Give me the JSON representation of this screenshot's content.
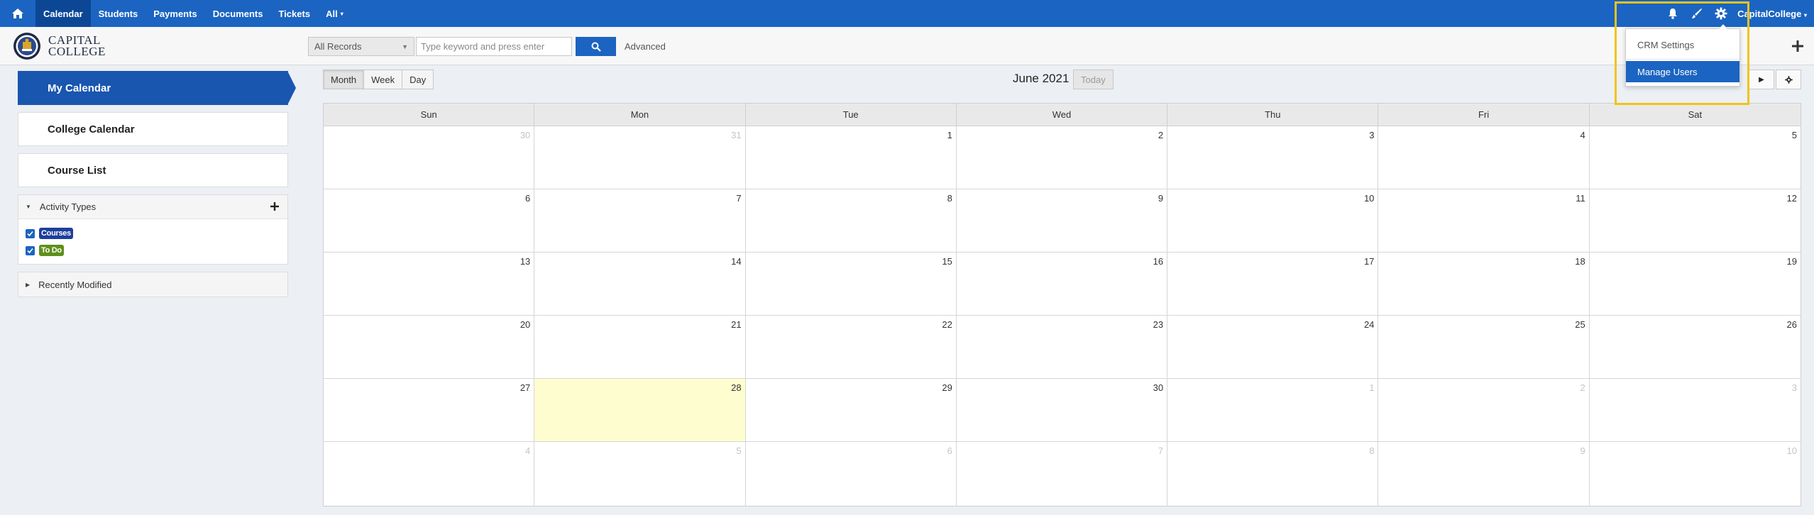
{
  "nav": {
    "items": [
      {
        "label": "Calendar",
        "active": true
      },
      {
        "label": "Students"
      },
      {
        "label": "Payments"
      },
      {
        "label": "Documents"
      },
      {
        "label": "Tickets"
      },
      {
        "label": "All",
        "caret": "▾"
      }
    ],
    "user": "CapitalCollege",
    "user_caret": "▾",
    "icons": [
      "home-icon",
      "bell-icon",
      "brush-icon",
      "gear-icon"
    ],
    "accent_color": "#1b64c1"
  },
  "logo": {
    "line1": "CAPITAL",
    "line2": "COLLEGE"
  },
  "search": {
    "records_select": "All Records",
    "placeholder": "Type keyword and press enter",
    "advanced": "Advanced"
  },
  "sidebar": {
    "buttons": [
      {
        "label": "My Calendar",
        "active": true
      },
      {
        "label": "College Calendar"
      },
      {
        "label": "Course List"
      }
    ],
    "activity_types": {
      "title": "Activity Types",
      "items": [
        {
          "label": "Courses",
          "checked": true,
          "color": "#1d3f9c"
        },
        {
          "label": "To Do",
          "checked": true,
          "color": "#5f8f1c"
        }
      ]
    },
    "recently_modified": {
      "title": "Recently Modified"
    }
  },
  "calendar": {
    "views": [
      "Month",
      "Week",
      "Day"
    ],
    "active_view": "Month",
    "title": "June 2021",
    "today_label": "Today",
    "weekdays": [
      "Sun",
      "Mon",
      "Tue",
      "Wed",
      "Thu",
      "Fri",
      "Sat"
    ],
    "weeks": [
      [
        {
          "d": "30",
          "o": true
        },
        {
          "d": "31",
          "o": true
        },
        {
          "d": "1"
        },
        {
          "d": "2"
        },
        {
          "d": "3"
        },
        {
          "d": "4"
        },
        {
          "d": "5"
        }
      ],
      [
        {
          "d": "6"
        },
        {
          "d": "7"
        },
        {
          "d": "8"
        },
        {
          "d": "9"
        },
        {
          "d": "10"
        },
        {
          "d": "11"
        },
        {
          "d": "12"
        }
      ],
      [
        {
          "d": "13"
        },
        {
          "d": "14"
        },
        {
          "d": "15"
        },
        {
          "d": "16"
        },
        {
          "d": "17"
        },
        {
          "d": "18"
        },
        {
          "d": "19"
        }
      ],
      [
        {
          "d": "20"
        },
        {
          "d": "21"
        },
        {
          "d": "22"
        },
        {
          "d": "23"
        },
        {
          "d": "24"
        },
        {
          "d": "25"
        },
        {
          "d": "26"
        }
      ],
      [
        {
          "d": "27"
        },
        {
          "d": "28",
          "today": true
        },
        {
          "d": "29"
        },
        {
          "d": "30"
        },
        {
          "d": "1",
          "o": true
        },
        {
          "d": "2",
          "o": true
        },
        {
          "d": "3",
          "o": true
        }
      ],
      [
        {
          "d": "4",
          "o": true
        },
        {
          "d": "5",
          "o": true
        },
        {
          "d": "6",
          "o": true
        },
        {
          "d": "7",
          "o": true
        },
        {
          "d": "8",
          "o": true
        },
        {
          "d": "9",
          "o": true
        },
        {
          "d": "10",
          "o": true
        }
      ]
    ]
  },
  "settings_menu": {
    "items": [
      {
        "label": "CRM Settings"
      },
      {
        "label": "Manage Users",
        "selected": true
      }
    ]
  }
}
